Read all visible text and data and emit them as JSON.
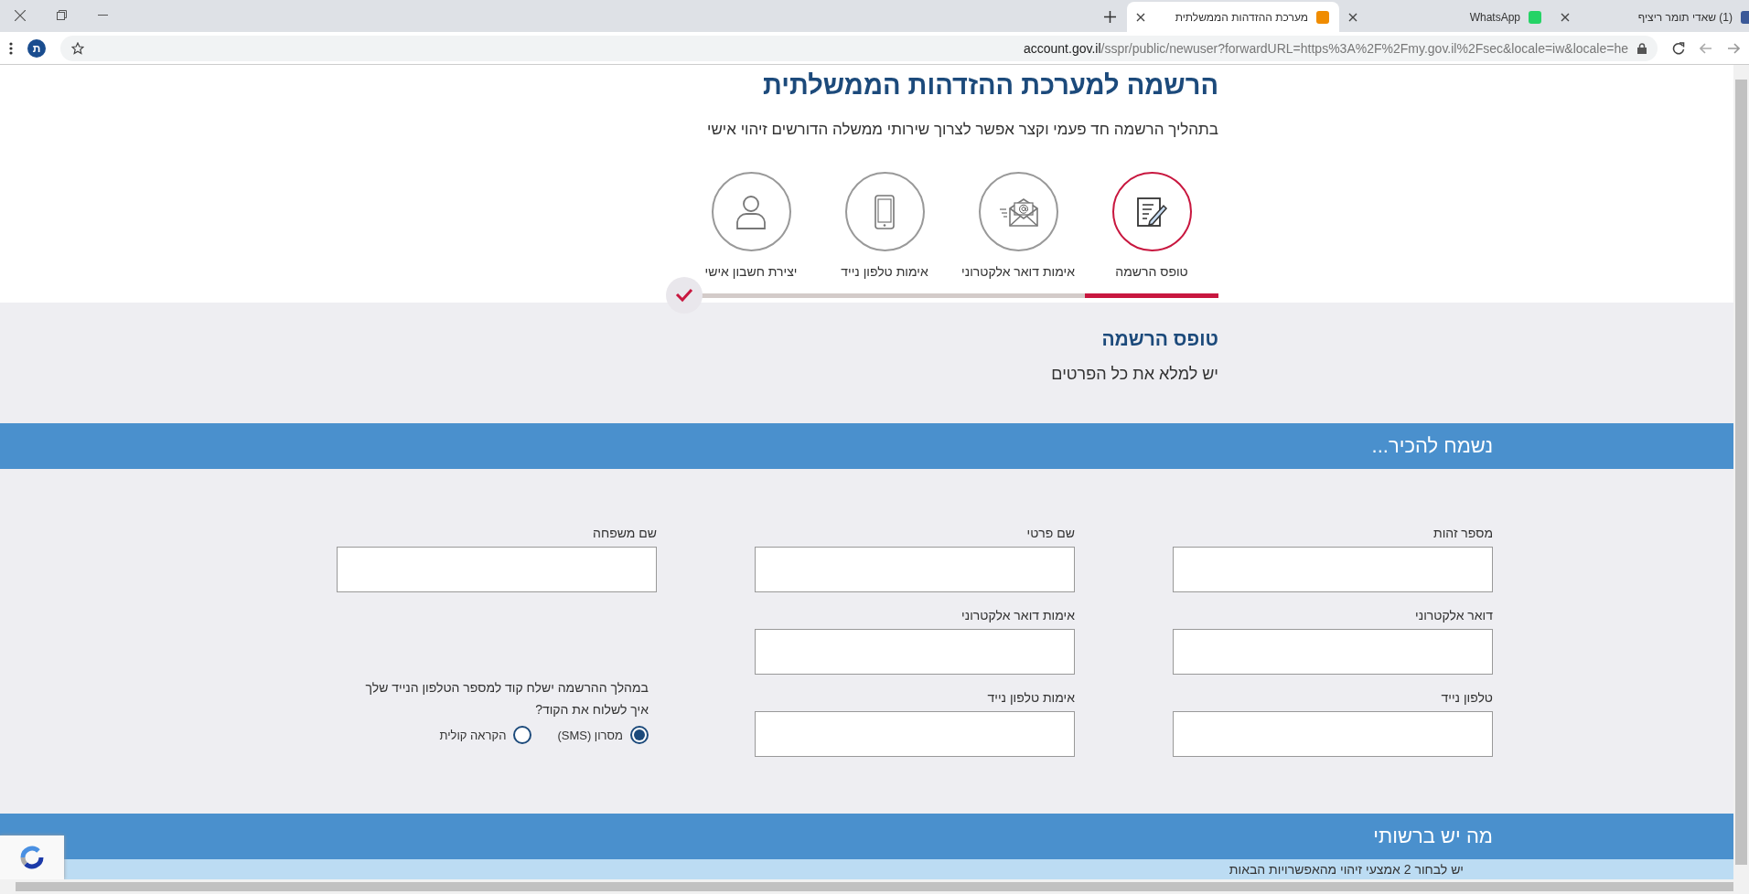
{
  "browser": {
    "tabs": [
      {
        "title": "(1) שאדי תומר ריציף",
        "selected": false
      },
      {
        "title": "WhatsApp",
        "selected": false
      },
      {
        "title": "מערכת ההזדהות הממשלתית",
        "selected": true
      }
    ],
    "url_host": "account.gov.il",
    "url_path": "/sspr/public/newuser?forwardURL=https%3A%2F%2Fmy.gov.il%2Fsec&locale=iw&locale=he",
    "profile_initial": "ת"
  },
  "header": {
    "title": "הרשמה למערכת ההזדהות הממשלתית",
    "subtitle": "בתהליך הרשמה חד פעמי וקצר אפשר לצרוך שירותי ממשלה הדורשים זיהוי אישי"
  },
  "steps": [
    {
      "label": "טופס הרשמה",
      "kind": "form",
      "selected": true
    },
    {
      "label": "אימות דואר אלקטרוני",
      "kind": "email",
      "selected": false
    },
    {
      "label": "אימות טלפון נייד",
      "kind": "phone",
      "selected": false
    },
    {
      "label": "יצירת חשבון אישי",
      "kind": "account",
      "selected": false
    }
  ],
  "form_intro": {
    "title": "טופס הרשמה",
    "subtitle": "יש למלא את כל הפרטים"
  },
  "section": {
    "title": "נשמח להכיר..."
  },
  "fields": [
    {
      "label": "מספר זהות"
    },
    {
      "label": "שם פרטי"
    },
    {
      "label": "שם משפחה"
    },
    {
      "label": "דואר אלקטרוני"
    },
    {
      "label": "אימות דואר אלקטרוני"
    },
    {
      "label": "טלפון נייד"
    },
    {
      "label": "אימות טלפון נייד"
    }
  ],
  "code_delivery": {
    "note": "במהלך ההרשמה ישלח קוד למספר הטלפון הנייד שלך",
    "question": "איך לשלוח את הקוד?",
    "options": [
      {
        "label": "מסרון (SMS)",
        "selected": true
      },
      {
        "label": "הקראה קולית",
        "selected": false
      }
    ]
  },
  "section_2": {
    "title": "מה יש ברשותי",
    "text": "יש לבחור 2 אמצעי זיהוי מהאפשרויות הבאות"
  }
}
